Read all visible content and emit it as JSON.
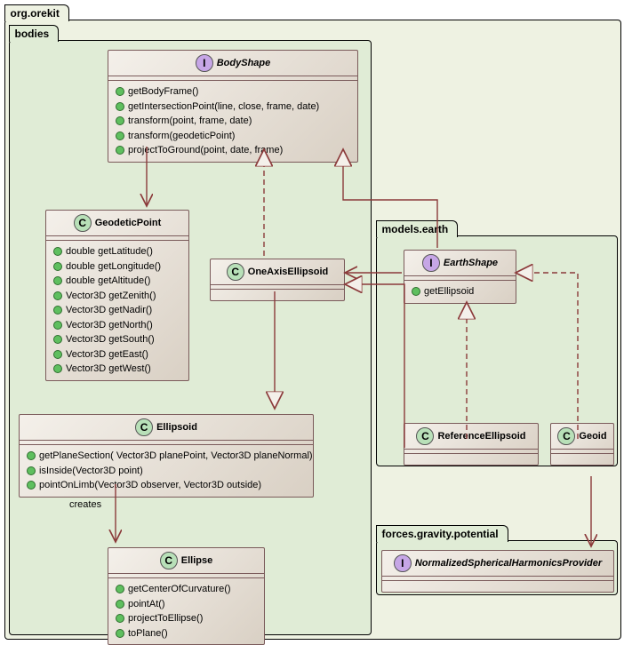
{
  "packages": {
    "outer": "org.orekit",
    "bodies": "bodies",
    "models_earth": "models.earth",
    "forces_gravity": "forces.gravity.potential"
  },
  "BodyShape": {
    "name": "BodyShape",
    "members": [
      "getBodyFrame()",
      "getIntersectionPoint(line, close, frame, date)",
      "transform(point, frame, date)",
      "transform(geodeticPoint)",
      "projectToGround(point, date, frame)"
    ]
  },
  "GeodeticPoint": {
    "name": "GeodeticPoint",
    "members": [
      "double getLatitude()",
      "double getLongitude()",
      "double getAltitude()",
      "Vector3D getZenith()",
      "Vector3D getNadir()",
      "Vector3D getNorth()",
      "Vector3D getSouth()",
      "Vector3D getEast()",
      "Vector3D getWest()"
    ]
  },
  "OneAxisEllipsoid": {
    "name": "OneAxisEllipsoid"
  },
  "Ellipsoid": {
    "name": "Ellipsoid",
    "members": [
      "getPlaneSection( Vector3D planePoint, Vector3D planeNormal)",
      "isInside(Vector3D point)",
      "pointOnLimb(Vector3D observer, Vector3D outside)"
    ]
  },
  "Ellipse": {
    "name": "Ellipse",
    "members": [
      "getCenterOfCurvature()",
      "pointAt()",
      "projectToEllipse()",
      "toPlane()"
    ]
  },
  "EarthShape": {
    "name": "EarthShape",
    "members": [
      "getEllipsoid"
    ]
  },
  "ReferenceEllipsoid": {
    "name": "ReferenceEllipsoid"
  },
  "Geoid": {
    "name": "Geoid"
  },
  "NormalizedSphericalHarmonicsProvider": {
    "name": "NormalizedSphericalHarmonicsProvider"
  },
  "labels": {
    "creates": "creates"
  },
  "chart_data": {
    "type": "uml-class-diagram",
    "packages": [
      {
        "name": "org.orekit",
        "children": [
          "bodies",
          "models.earth",
          "forces.gravity.potential"
        ]
      },
      {
        "name": "bodies",
        "classes": [
          "BodyShape",
          "GeodeticPoint",
          "OneAxisEllipsoid",
          "Ellipsoid",
          "Ellipse"
        ]
      },
      {
        "name": "models.earth",
        "classes": [
          "EarthShape",
          "ReferenceEllipsoid",
          "Geoid"
        ]
      },
      {
        "name": "forces.gravity.potential",
        "classes": [
          "NormalizedSphericalHarmonicsProvider"
        ]
      }
    ],
    "classes": [
      {
        "name": "BodyShape",
        "stereotype": "interface",
        "methods": [
          "getBodyFrame()",
          "getIntersectionPoint(line, close, frame, date)",
          "transform(point, frame, date)",
          "transform(geodeticPoint)",
          "projectToGround(point, date, frame)"
        ]
      },
      {
        "name": "GeodeticPoint",
        "stereotype": "class",
        "methods": [
          "double getLatitude()",
          "double getLongitude()",
          "double getAltitude()",
          "Vector3D getZenith()",
          "Vector3D getNadir()",
          "Vector3D getNorth()",
          "Vector3D getSouth()",
          "Vector3D getEast()",
          "Vector3D getWest()"
        ]
      },
      {
        "name": "OneAxisEllipsoid",
        "stereotype": "class"
      },
      {
        "name": "Ellipsoid",
        "stereotype": "class",
        "methods": [
          "getPlaneSection( Vector3D planePoint, Vector3D planeNormal)",
          "isInside(Vector3D point)",
          "pointOnLimb(Vector3D observer, Vector3D outside)"
        ]
      },
      {
        "name": "Ellipse",
        "stereotype": "class",
        "methods": [
          "getCenterOfCurvature()",
          "pointAt()",
          "projectToEllipse()",
          "toPlane()"
        ]
      },
      {
        "name": "EarthShape",
        "stereotype": "interface",
        "methods": [
          "getEllipsoid"
        ]
      },
      {
        "name": "ReferenceEllipsoid",
        "stereotype": "class"
      },
      {
        "name": "Geoid",
        "stereotype": "class"
      },
      {
        "name": "NormalizedSphericalHarmonicsProvider",
        "stereotype": "interface"
      }
    ],
    "relationships": [
      {
        "from": "BodyShape",
        "to": "GeodeticPoint",
        "type": "association",
        "arrow": "open"
      },
      {
        "from": "OneAxisEllipsoid",
        "to": "BodyShape",
        "type": "realization",
        "dashed": true
      },
      {
        "from": "EarthShape",
        "to": "BodyShape",
        "type": "generalization",
        "dashed": false
      },
      {
        "from": "EarthShape",
        "to": "OneAxisEllipsoid",
        "type": "association",
        "arrow": "open"
      },
      {
        "from": "OneAxisEllipsoid",
        "to": "Ellipsoid",
        "type": "generalization"
      },
      {
        "from": "Ellipsoid",
        "to": "Ellipse",
        "type": "dependency",
        "label": "creates",
        "arrow": "open"
      },
      {
        "from": "ReferenceEllipsoid",
        "to": "EarthShape",
        "type": "realization",
        "dashed": true
      },
      {
        "from": "ReferenceEllipsoid",
        "to": "OneAxisEllipsoid",
        "type": "generalization"
      },
      {
        "from": "Geoid",
        "to": "EarthShape",
        "type": "realization",
        "dashed": true
      },
      {
        "from": "Geoid",
        "to": "NormalizedSphericalHarmonicsProvider",
        "type": "association",
        "arrow": "open"
      }
    ]
  }
}
